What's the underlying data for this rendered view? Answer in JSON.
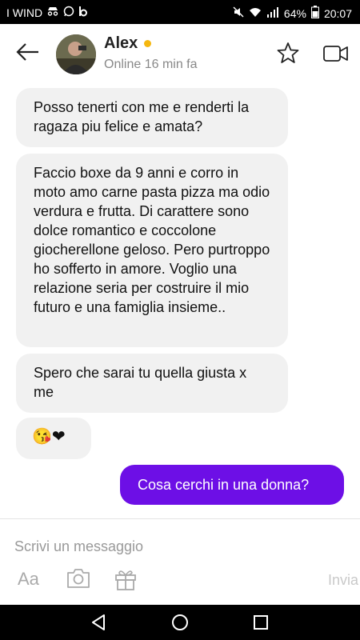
{
  "status_bar": {
    "carrier": "I WIND",
    "battery": "64%",
    "time": "20:07"
  },
  "header": {
    "name": "Alex",
    "status": "Online 16 min fa",
    "online_dot_color": "#f5b70f"
  },
  "messages": [
    {
      "direction": "in",
      "text": "Posso tenerti con me e renderti la ragaza piu felice e amata?"
    },
    {
      "direction": "in",
      "text": "Faccio boxe da 9 anni e corro in moto amo carne pasta pizza ma odio verdura e frutta. Di carattere sono dolce romantico e coccolone giocherellone geloso. Pero purtroppo ho sofferto in amore. Voglio una relazione seria per costruire il mio futuro e una famiglia insieme.."
    },
    {
      "direction": "in",
      "text": "Spero che sarai tu quella giusta x me"
    },
    {
      "direction": "in",
      "text": "😘❤"
    },
    {
      "direction": "out",
      "text": "Cosa cerchi in una donna?"
    }
  ],
  "composer": {
    "placeholder": "Scrivi un messaggio",
    "font_tool_label": "Aa",
    "send_label": "Invia"
  },
  "colors": {
    "outgoing_bubble": "#6d0fe6",
    "incoming_bubble": "#f1f1f1"
  },
  "icons": [
    "back-arrow-icon",
    "star-icon",
    "video-call-icon",
    "camera-icon",
    "gift-icon",
    "nav-back-icon",
    "nav-home-icon",
    "nav-recents-icon"
  ]
}
